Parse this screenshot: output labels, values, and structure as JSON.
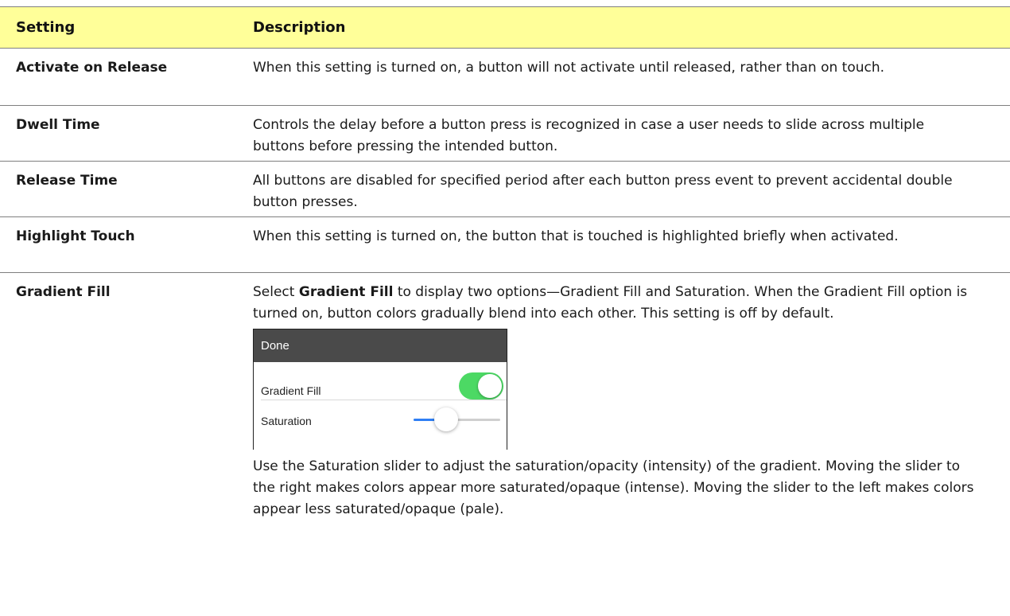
{
  "table": {
    "headers": {
      "setting": "Setting",
      "description": "Description"
    },
    "rows": [
      {
        "setting": "Activate on Release",
        "description": "When this setting is turned on, a button will not activate until released, rather than on touch."
      },
      {
        "setting": "Dwell Time",
        "description": "Controls the delay before a button press is recognized in case a user needs to slide across multiple buttons before pressing the intended button."
      },
      {
        "setting": "Release Time",
        "description": "All buttons are disabled for specified period after each button press event to prevent accidental double button presses."
      },
      {
        "setting": "Highlight Touch",
        "description": "When this setting is turned on, the button that is touched is highlighted briefly when activated."
      },
      {
        "setting": "Gradient Fill",
        "description_intro_bold": "Gradient Fill",
        "description_intro_pre": "Select ",
        "description_intro_post": " to display two options—Gradient Fill and Saturation. When the Gradient Fill option is turned on, button colors gradually blend into each other. This setting is off by default.",
        "description_after": "Use the Saturation slider to adjust the saturation/opacity (intensity) of the gradient. Moving the slider to the right makes colors appear more saturated/opaque (intense). Moving the slider to the left makes colors appear less saturated/opaque (pale)."
      }
    ]
  },
  "mini_screenshot": {
    "done_label": "Done",
    "gradient_fill_label": "Gradient Fill",
    "gradient_fill_on": true,
    "saturation_label": "Saturation",
    "saturation_level": 0.38,
    "colors": {
      "toggle_on": "#4cd964",
      "slider_fill": "#2f7ff5",
      "bar": "#4a4a4a"
    }
  },
  "colors": {
    "header_bg": "#ffff99",
    "rule": "#7f7f7f"
  }
}
